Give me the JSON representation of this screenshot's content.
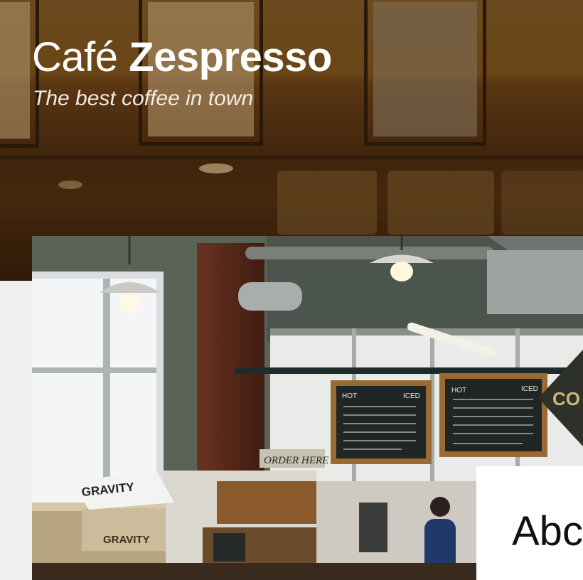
{
  "header": {
    "brand_light": "Café",
    "brand_bold": "Zespresso",
    "tagline": "The best coffee in town"
  },
  "photo": {
    "menu_left_title": "HOT",
    "menu_left_iced": "ICED",
    "menu_right_title": "HOT",
    "menu_right_iced": "ICED",
    "order_sign": "ORDER HERE",
    "box_label": "GRAVITY",
    "crate_label": "GRAVITY",
    "side_sign": "CO"
  },
  "about": {
    "heading": "Abc"
  },
  "colors": {
    "hero_overlay": "#5a3612",
    "page_background": "#efefed",
    "card_background": "#ffffff"
  }
}
